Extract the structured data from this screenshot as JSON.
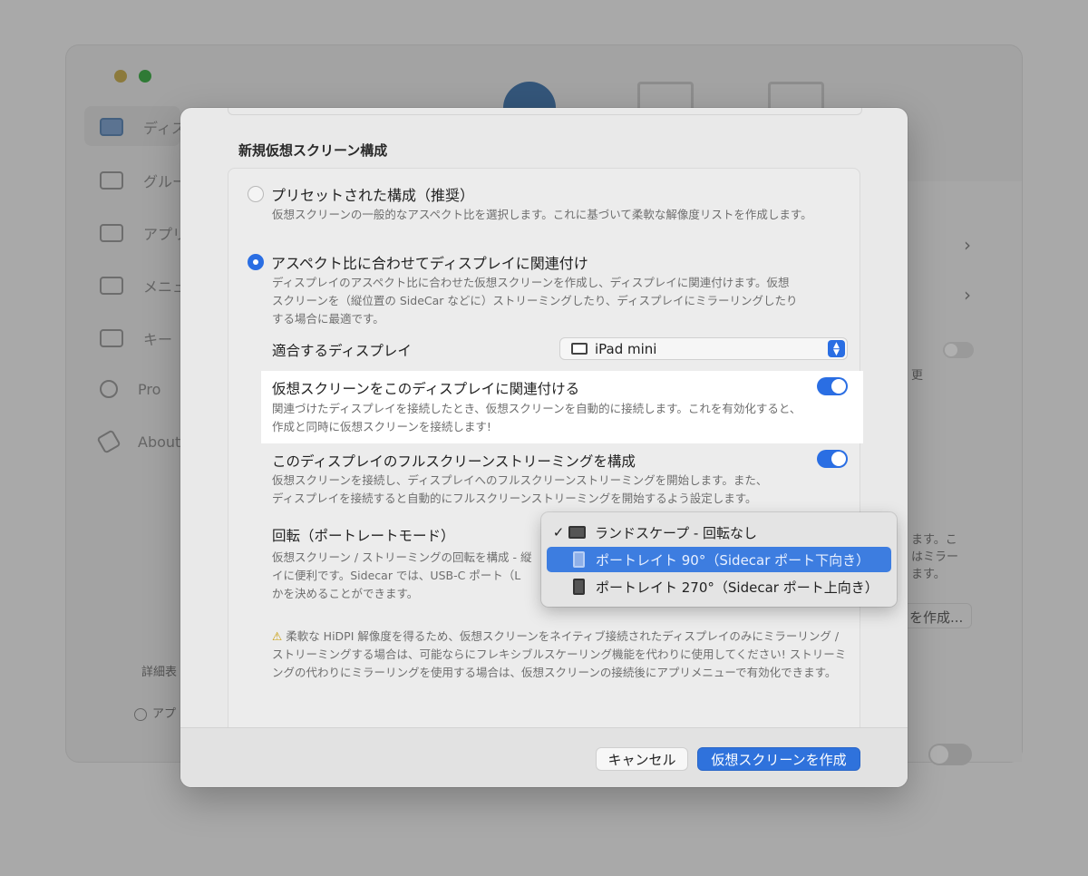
{
  "background": {
    "sidebar": [
      {
        "label": "ディス"
      },
      {
        "label": "グルー"
      },
      {
        "label": "アプリ"
      },
      {
        "label": "メニュ"
      },
      {
        "label": "キー"
      },
      {
        "label": "Pro"
      },
      {
        "label": "About"
      }
    ],
    "bottom_left_label": "詳細表",
    "bottom_left_item": "アプ",
    "right_snippets": [
      "更",
      "ます。こ",
      "はミラー",
      "ます。"
    ],
    "create_button_partial": "を作成..."
  },
  "sheet": {
    "title": "新規仮想スクリーン構成",
    "option_preset": {
      "label": "プリセットされた構成（推奨）",
      "description": "仮想スクリーンの一般的なアスペクト比を選択します。これに基づいて柔軟な解像度リストを作成します。",
      "selected": false
    },
    "option_aspect": {
      "label": "アスペクト比に合わせてディスプレイに関連付け",
      "description_lines": [
        "ディスプレイのアスペクト比に合わせた仮想スクリーンを作成し、ディスプレイに関連付けます。仮想",
        "スクリーンを（縦位置の SideCar などに）ストリーミングしたり、ディスプレイにミラーリングしたり",
        "する場合に最適です。"
      ],
      "selected": true
    },
    "matching_display": {
      "label": "適合するディスプレイ",
      "value": "iPad mini"
    },
    "associate": {
      "label": "仮想スクリーンをこのディスプレイに関連付ける",
      "description_lines": [
        "関連づけたディスプレイを接続したとき、仮想スクリーンを自動的に接続します。これを有効化すると、",
        "作成と同時に仮想スクリーンを接続します!"
      ],
      "enabled": true
    },
    "fullscreen": {
      "label": "このディスプレイのフルスクリーンストリーミングを構成",
      "description_lines": [
        "仮想スクリーンを接続し、ディスプレイへのフルスクリーンストリーミングを開始します。また、",
        "ディスプレイを接続すると自動的にフルスクリーンストリーミングを開始するよう設定します。"
      ],
      "enabled": true
    },
    "rotation": {
      "label": "回転（ポートレートモード）",
      "description_lines": [
        "仮想スクリーン / ストリーミングの回転を構成 - 縦",
        "イに便利です。Sidecar では、USB-C ポート（L",
        "かを決めることができます。"
      ]
    },
    "warning": {
      "icon": "warning-icon",
      "text": "柔軟な HiDPI 解像度を得るため、仮想スクリーンをネイティブ接続されたディスプレイのみにミラーリング / ストリーミングする場合は、可能ならにフレキシブルスケーリング機能を代わりに使用してください! ストリーミングの代わりにミラーリングを使用する場合は、仮想スクリーンの接続後にアプリメニューで有効化できます。"
    },
    "buttons": {
      "cancel": "キャンセル",
      "create": "仮想スクリーンを作成"
    }
  },
  "rotation_menu": {
    "items": [
      {
        "label": "ランドスケープ - 回転なし",
        "checked": true,
        "highlighted": false,
        "icon": "landscape-device-icon"
      },
      {
        "label": "ポートレイト 90°（Sidecar ポート下向き）",
        "checked": false,
        "highlighted": true,
        "icon": "portrait-device-icon"
      },
      {
        "label": "ポートレイト 270°（Sidecar ポート上向き）",
        "checked": false,
        "highlighted": false,
        "icon": "portrait-device-icon"
      }
    ]
  },
  "colors": {
    "accent": "#2a6ee3",
    "menu_highlight": "#3d7de0",
    "sheet_bg": "#e9e9e9",
    "dim_bg": "#a9a9a9"
  }
}
